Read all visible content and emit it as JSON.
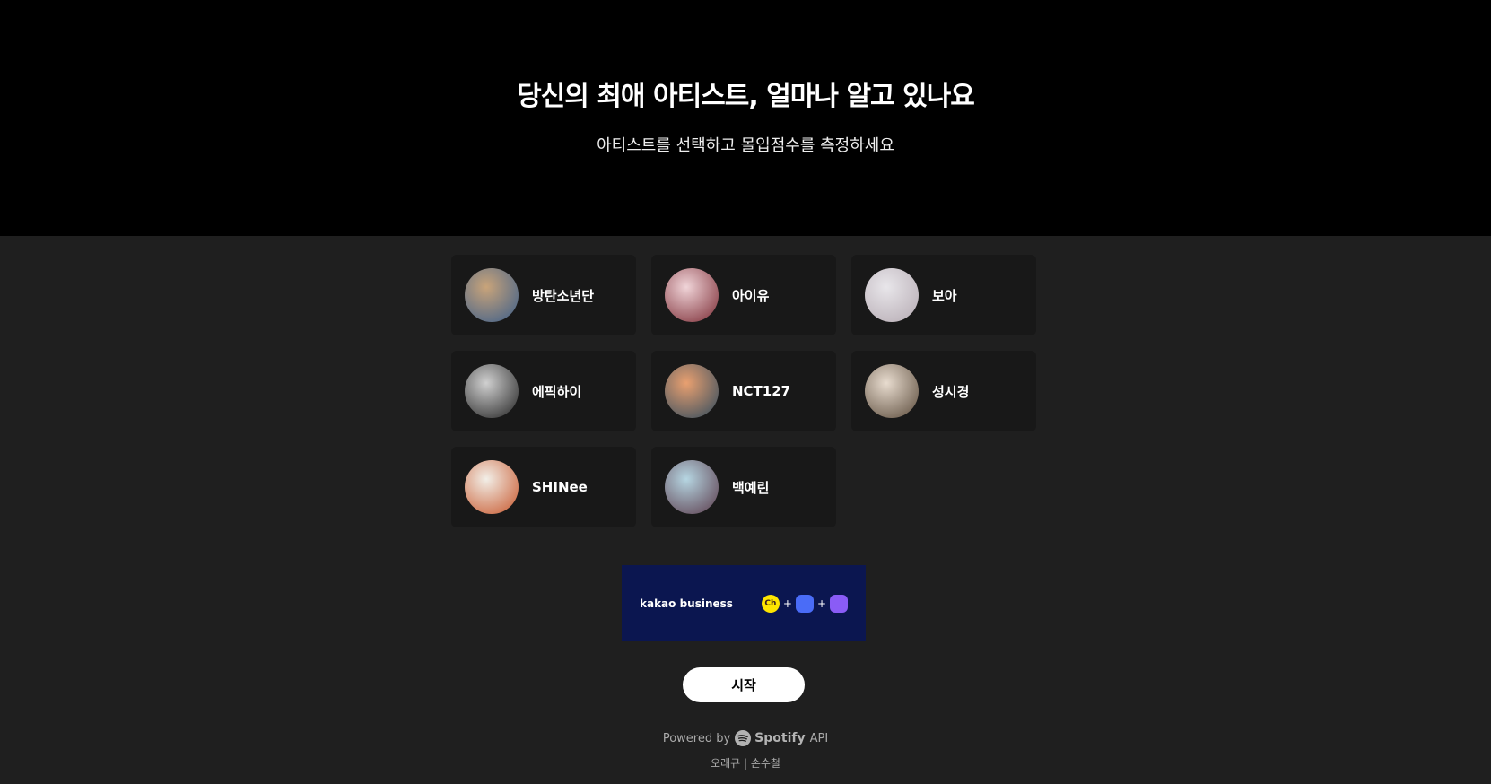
{
  "hero": {
    "title": "당신의 최애 아티스트, 얼마나 알고 있나요",
    "subtitle": "아티스트를 선택하고 몰입점수를 측정하세요"
  },
  "artists": [
    {
      "name": "방탄소년단",
      "avatar_colors": [
        "#c9a47a",
        "#3a5d8a"
      ]
    },
    {
      "name": "아이유",
      "avatar_colors": [
        "#f0d4d8",
        "#7a2a33"
      ]
    },
    {
      "name": "보아",
      "avatar_colors": [
        "#e8e6ea",
        "#b5aab2"
      ]
    },
    {
      "name": "에픽하이",
      "avatar_colors": [
        "#d0d0d0",
        "#222222"
      ]
    },
    {
      "name": "NCT127",
      "avatar_colors": [
        "#e9a070",
        "#2e4a5e"
      ]
    },
    {
      "name": "성시경",
      "avatar_colors": [
        "#e8dccf",
        "#5a4a3a"
      ]
    },
    {
      "name": "SHINee",
      "avatar_colors": [
        "#f2efe8",
        "#c7552a"
      ]
    },
    {
      "name": "백예린",
      "avatar_colors": [
        "#b6d6e2",
        "#5a3a4a"
      ]
    }
  ],
  "ad": {
    "brand": "kakao business",
    "icon1": "Ch",
    "plus": "+",
    "colors": {
      "bg": "#0b1650",
      "yellow": "#fee500",
      "blue": "#4a6cf7",
      "purple": "#8a5cf6"
    }
  },
  "start_label": "시작",
  "footer": {
    "powered_prefix": "Powered by",
    "spotify": "Spotify",
    "api": "API",
    "credits": "오래규 | 손수철"
  }
}
